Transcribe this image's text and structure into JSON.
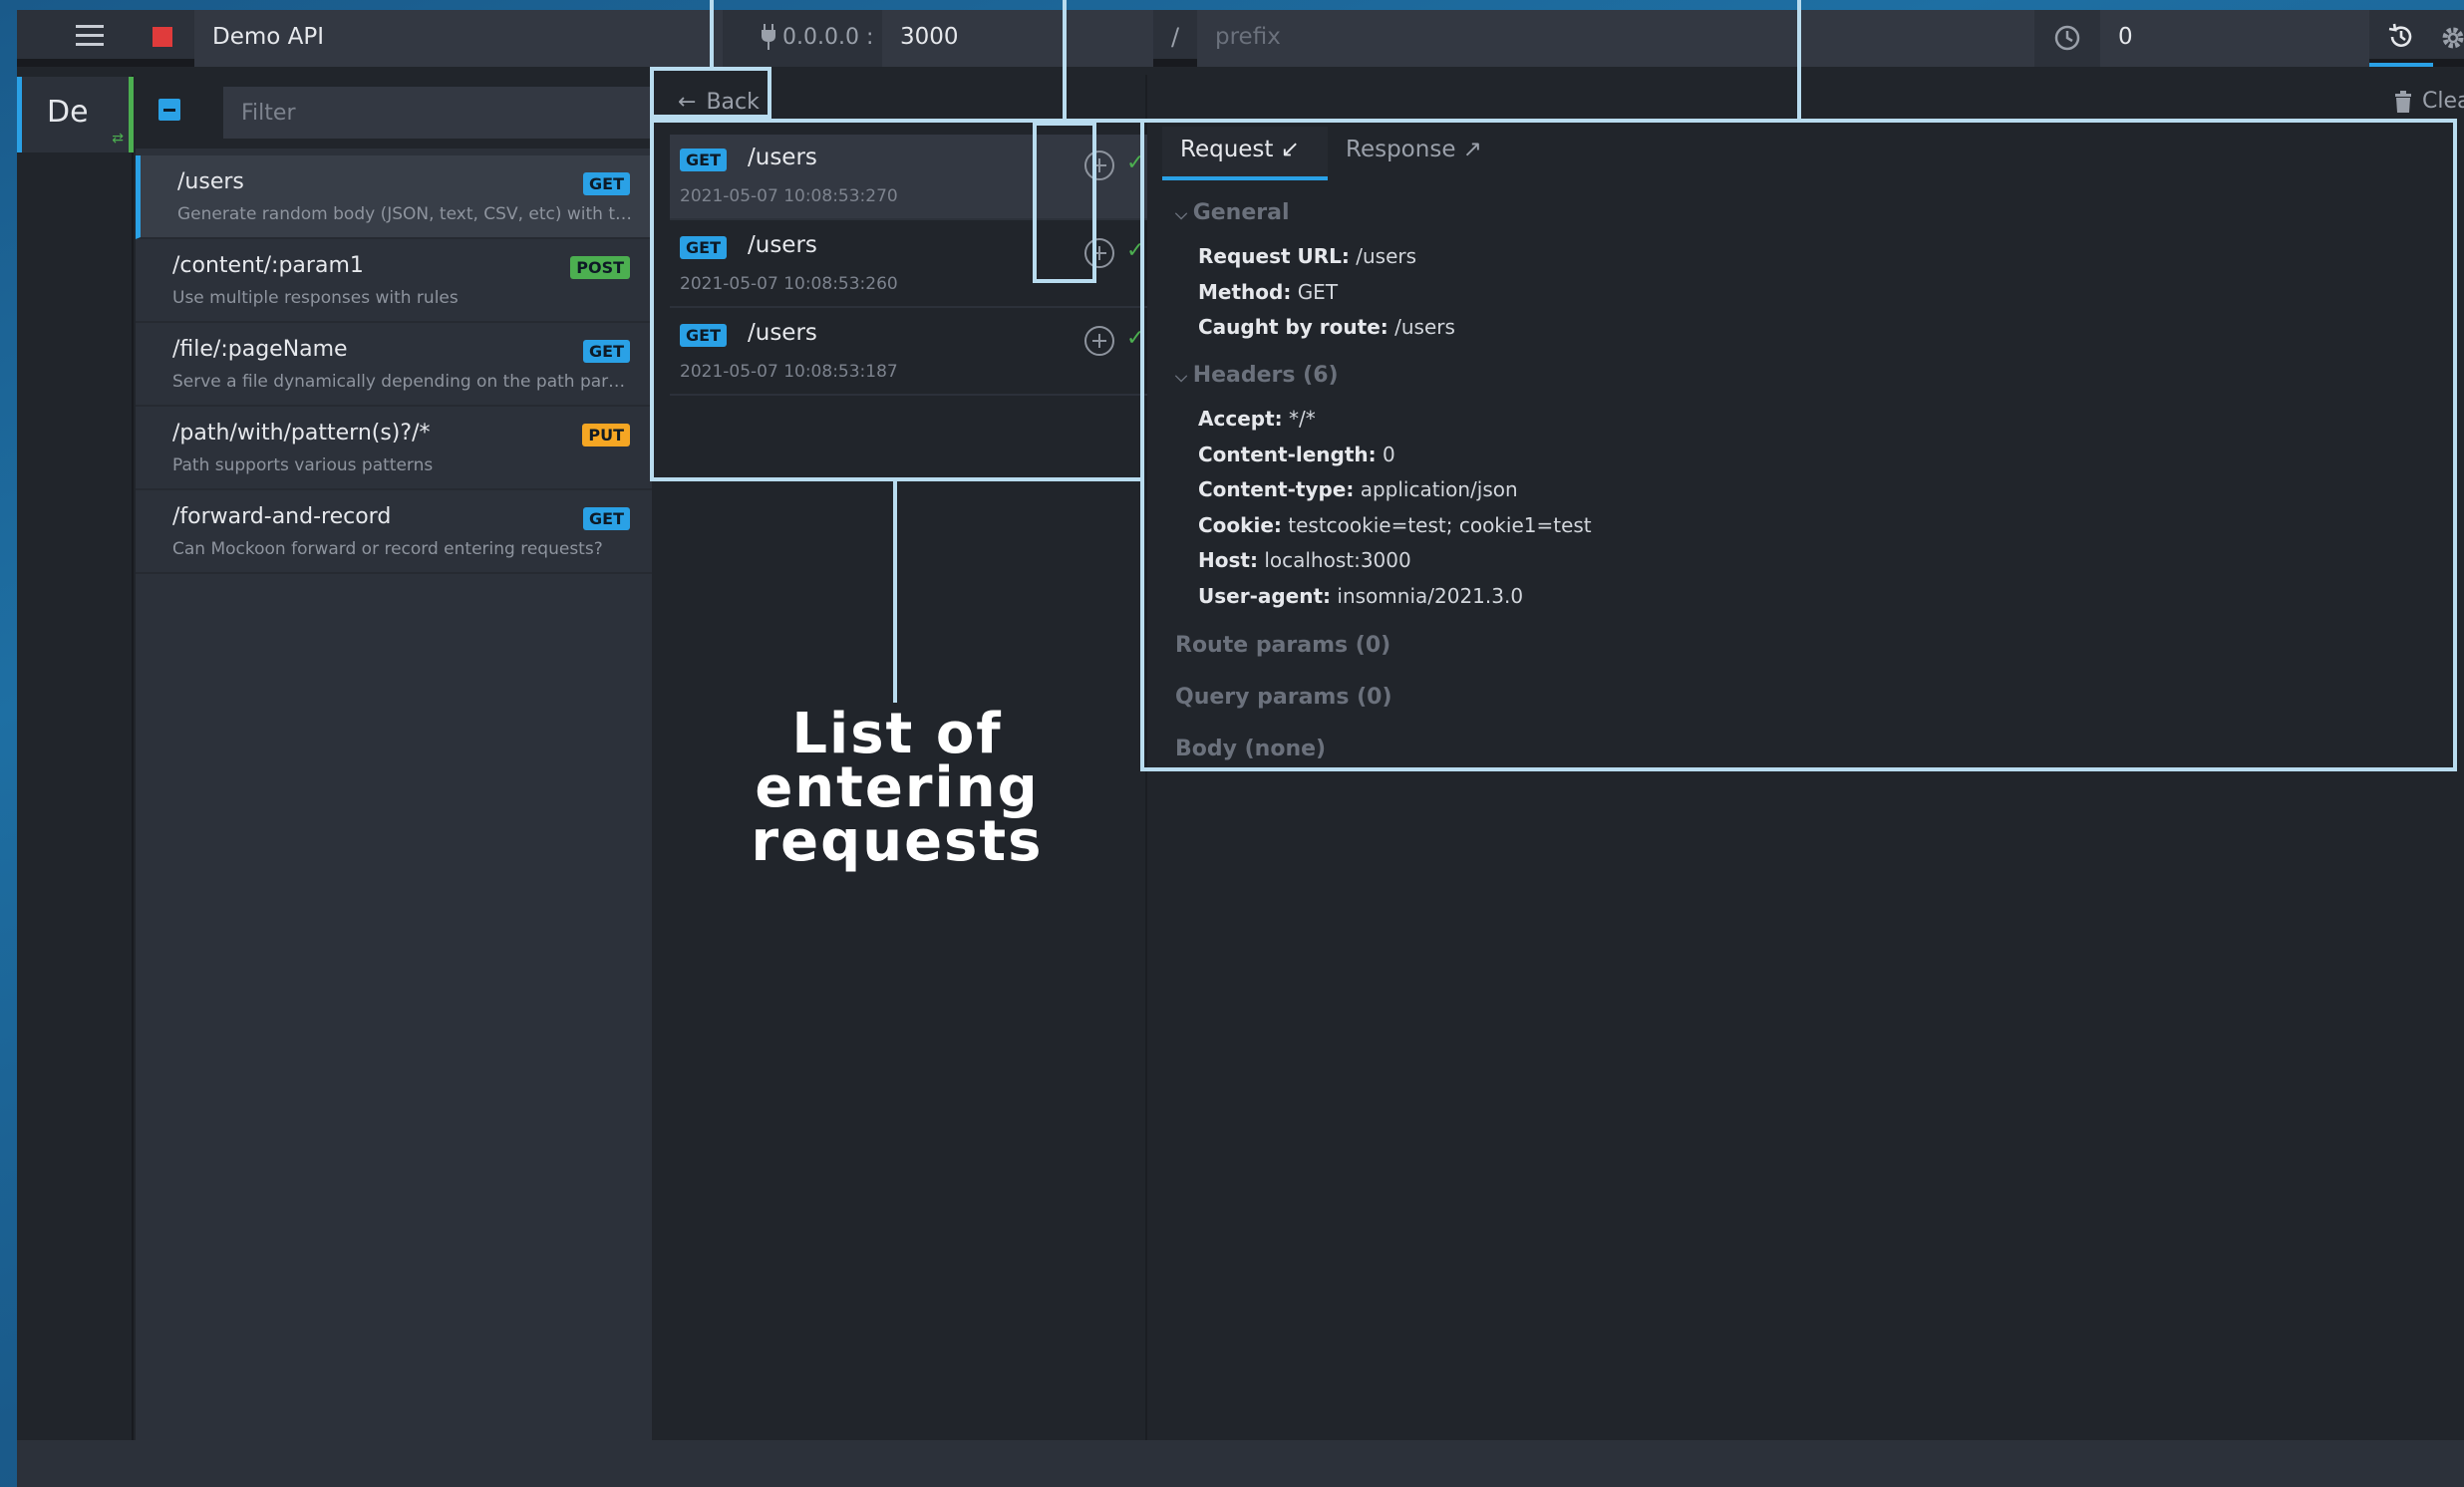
{
  "header": {
    "environment_name": "Demo API",
    "host": "0.0.0.0 :",
    "port": "3000",
    "slash": "/",
    "prefix_placeholder": "prefix",
    "latency": "0"
  },
  "environments": [
    {
      "label": "De"
    }
  ],
  "routes": {
    "filter_placeholder": "Filter",
    "items": [
      {
        "path": "/users",
        "method": "GET",
        "description": "Generate random body (JSON, text, CSV, etc) with te..."
      },
      {
        "path": "/content/:param1",
        "method": "POST",
        "description": "Use multiple responses with rules"
      },
      {
        "path": "/file/:pageName",
        "method": "GET",
        "description": "Serve a file dynamically depending on the path para..."
      },
      {
        "path": "/path/with/pattern(s)?/*",
        "method": "PUT",
        "description": "Path supports various patterns"
      },
      {
        "path": "/forward-and-record",
        "method": "GET",
        "description": "Can Mockoon forward or record entering requests?"
      }
    ]
  },
  "logs": {
    "back_label": "Back",
    "clear_label": "Clear",
    "items": [
      {
        "method": "GET",
        "path": "/users",
        "timestamp": "2021-05-07 10:08:53:270"
      },
      {
        "method": "GET",
        "path": "/users",
        "timestamp": "2021-05-07 10:08:53:260"
      },
      {
        "method": "GET",
        "path": "/users",
        "timestamp": "2021-05-07 10:08:53:187"
      }
    ]
  },
  "details": {
    "tab_request": "Request",
    "tab_response": "Response",
    "general_title": "General",
    "general": [
      {
        "key": "Request URL:",
        "value": "/users"
      },
      {
        "key": "Method:",
        "value": "GET"
      },
      {
        "key": "Caught by route:",
        "value": "/users"
      }
    ],
    "headers_title": "Headers (6)",
    "headers": [
      {
        "key": "Accept:",
        "value": "*/*"
      },
      {
        "key": "Content-length:",
        "value": "0"
      },
      {
        "key": "Content-type:",
        "value": "application/json"
      },
      {
        "key": "Cookie:",
        "value": "testcookie=test; cookie1=test"
      },
      {
        "key": "Host:",
        "value": "localhost:3000"
      },
      {
        "key": "User-agent:",
        "value": "insomnia/2021.3.0"
      }
    ],
    "route_params": "Route params (0)",
    "query_params": "Query params (0)",
    "body": "Body (none)"
  },
  "annotation": {
    "caption": "List of entering requests"
  },
  "colors": {
    "accent": "#2aa1e6",
    "get": "#2aa1e6",
    "post": "#4caf50",
    "put": "#f5a623",
    "stop": "#e03b3b",
    "annotation": "#b9dcef"
  },
  "icons": [
    "menu-icon",
    "stop-icon",
    "plug-icon",
    "clock-icon",
    "history-icon",
    "gear-icon",
    "add-icon",
    "back-arrow-icon",
    "mock-icon",
    "check-icon",
    "trash-icon"
  ]
}
